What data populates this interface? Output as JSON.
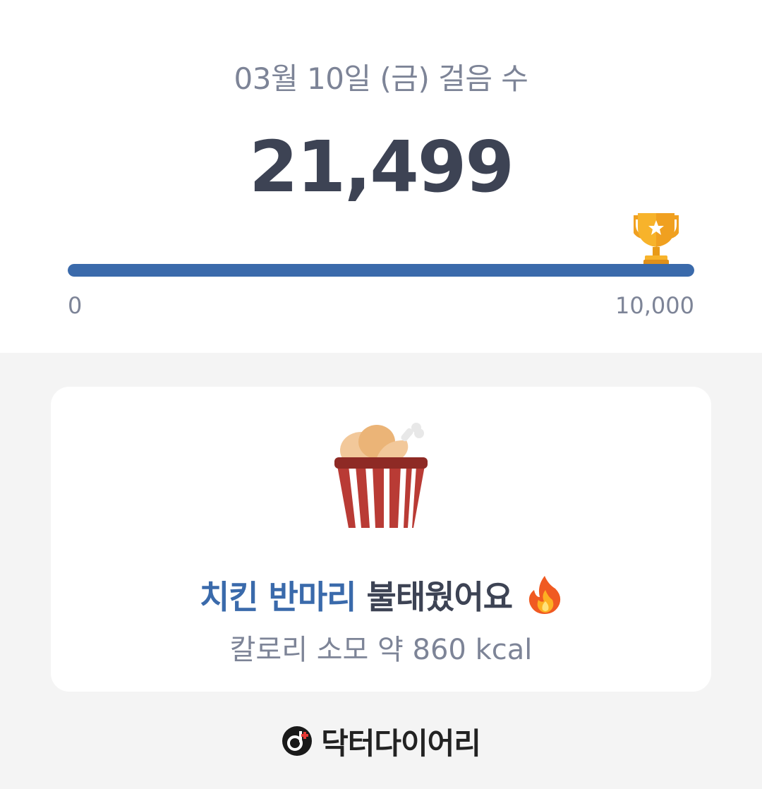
{
  "header": {
    "date_title": "03월 10일 (금) 걸음 수",
    "step_count": "21,499"
  },
  "progress": {
    "min_label": "0",
    "max_label": "10,000",
    "fraction": 1.0,
    "fill_color": "#3a6aab",
    "goal_icon": "trophy-icon"
  },
  "card": {
    "food_icon": "chicken-bucket-icon",
    "headline_accent": "치킨 반마리",
    "headline_rest": "불태웠어요",
    "headline_emoji": "fire-icon",
    "subline": "칼로리 소모 약 860 kcal"
  },
  "footer": {
    "brand_icon": "doctor-diary-logo-icon",
    "brand_name": "닥터다이어리"
  }
}
